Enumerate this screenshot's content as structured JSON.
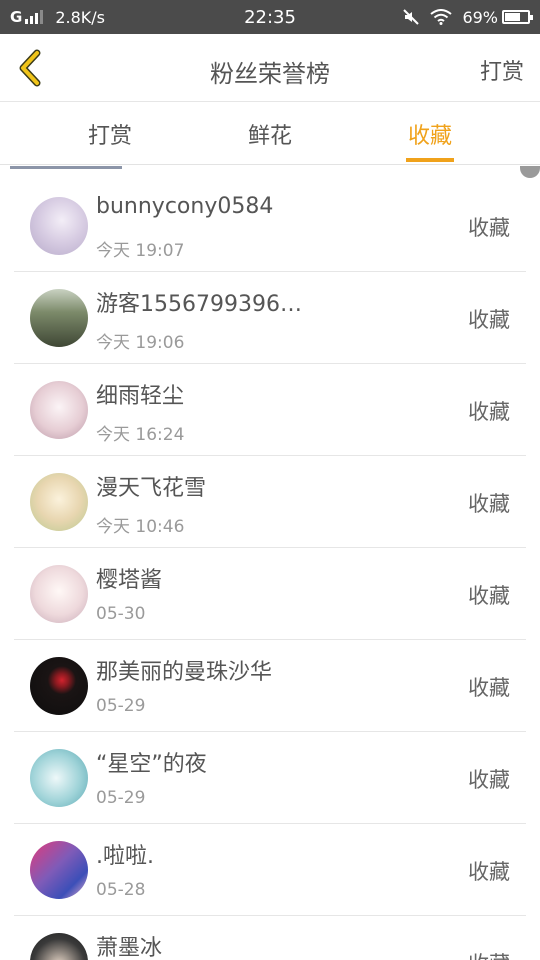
{
  "status_bar": {
    "carrier": "G",
    "speed": "2.8K/s",
    "time": "22:35",
    "battery": "69%",
    "battery_level": 0.69,
    "icons": [
      "signal-icon",
      "mute-icon",
      "wifi-icon",
      "battery-charging-icon"
    ]
  },
  "app_bar": {
    "back_icon": "chevron-left-icon",
    "title": "粉丝荣誉榜",
    "action": "打赏"
  },
  "tabs": [
    {
      "label": "打赏",
      "active": false
    },
    {
      "label": "鲜花",
      "active": false
    },
    {
      "label": "收藏",
      "active": true
    }
  ],
  "accent_color": "#f0a21b",
  "list": [
    {
      "name": "bunnycony0584",
      "time": "今天 19:07",
      "action": "收藏",
      "avatar_color": "#d8cde3"
    },
    {
      "name": "游客1556799396…",
      "time": "今天 19:06",
      "action": "收藏",
      "avatar_color": "#5b6a4a"
    },
    {
      "name": "细雨轻尘",
      "time": "今天 16:24",
      "action": "收藏",
      "avatar_color": "#e6cdd4"
    },
    {
      "name": "漫天飞花雪",
      "time": "今天 10:46",
      "action": "收藏",
      "avatar_color": "#e8d6b0"
    },
    {
      "name": "樱塔酱",
      "time": "05-30",
      "action": "收藏",
      "avatar_color": "#eed9dc"
    },
    {
      "name": "那美丽的曼珠沙华",
      "time": "05-29",
      "action": "收藏",
      "avatar_color": "#1a1414"
    },
    {
      "name": "“星空”的夜",
      "time": "05-29",
      "action": "收藏",
      "avatar_color": "#9fd3d8"
    },
    {
      "name": ".啦啦.",
      "time": "05-28",
      "action": "收藏",
      "avatar_color": "#7f5bb8"
    },
    {
      "name": "萧墨冰",
      "time": "",
      "action": "收藏",
      "avatar_color": "#3a3a3a"
    }
  ]
}
